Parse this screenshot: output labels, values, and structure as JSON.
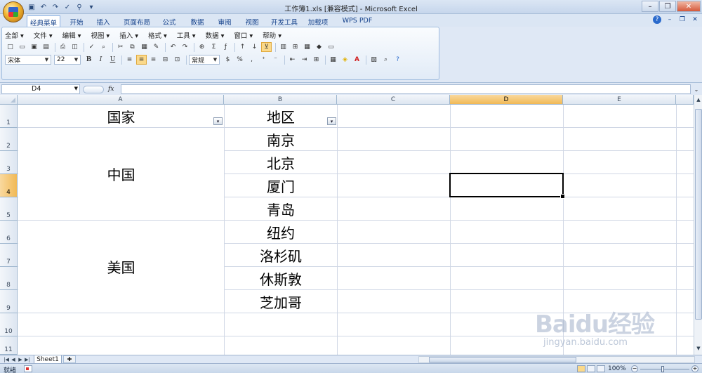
{
  "window": {
    "title": "工作簿1.xls  [兼容模式] - Microsoft Excel"
  },
  "ribbon_tabs": [
    {
      "label": "经典菜单",
      "active": true
    },
    {
      "label": "开始"
    },
    {
      "label": "插入"
    },
    {
      "label": "页面布局"
    },
    {
      "label": "公式"
    },
    {
      "label": "数据"
    },
    {
      "label": "审阅"
    },
    {
      "label": "视图"
    },
    {
      "label": "开发工具"
    },
    {
      "label": "加载项"
    },
    {
      "label": "WPS PDF"
    }
  ],
  "classic_menu": [
    {
      "label": "全部 ▾"
    },
    {
      "label": "文件 ▾"
    },
    {
      "label": "编辑 ▾"
    },
    {
      "label": "视图 ▾"
    },
    {
      "label": "插入 ▾"
    },
    {
      "label": "格式 ▾"
    },
    {
      "label": "工具 ▾"
    },
    {
      "label": "数据 ▾"
    },
    {
      "label": "窗口 ▾"
    },
    {
      "label": "帮助 ▾"
    }
  ],
  "format_toolbar": {
    "font_name": "宋体",
    "font_size": "22",
    "number_format": "常规",
    "bold": "B",
    "italic": "I",
    "underline": "U",
    "percent": "%",
    "comma": ","
  },
  "formula_bar": {
    "name_box": "D4",
    "fx": "fx",
    "formula": ""
  },
  "columns": [
    {
      "label": "A",
      "selected": false
    },
    {
      "label": "B",
      "selected": false
    },
    {
      "label": "C",
      "selected": false
    },
    {
      "label": "D",
      "selected": true
    },
    {
      "label": "E",
      "selected": false
    }
  ],
  "rows": [
    {
      "label": "1"
    },
    {
      "label": "2"
    },
    {
      "label": "3"
    },
    {
      "label": "4",
      "selected": true
    },
    {
      "label": "5"
    },
    {
      "label": "6"
    },
    {
      "label": "7"
    },
    {
      "label": "8"
    },
    {
      "label": "9"
    },
    {
      "label": "10"
    },
    {
      "label": "11"
    }
  ],
  "cells": {
    "A1": "国家",
    "B1": "地区",
    "A_china": "中国",
    "A_usa": "美国",
    "B2": "南京",
    "B3": "北京",
    "B4": "厦门",
    "B5": "青岛",
    "B6": "纽约",
    "B7": "洛杉矶",
    "B8": "休斯敦",
    "B9": "芝加哥"
  },
  "filter_arrow": "▾",
  "sheet_tabs": [
    {
      "label": "Sheet1",
      "active": true
    }
  ],
  "status": {
    "text": "就绪",
    "zoom": "100%"
  },
  "watermark": {
    "logo": "Baidu经验",
    "url": "jingyan.baidu.com"
  }
}
